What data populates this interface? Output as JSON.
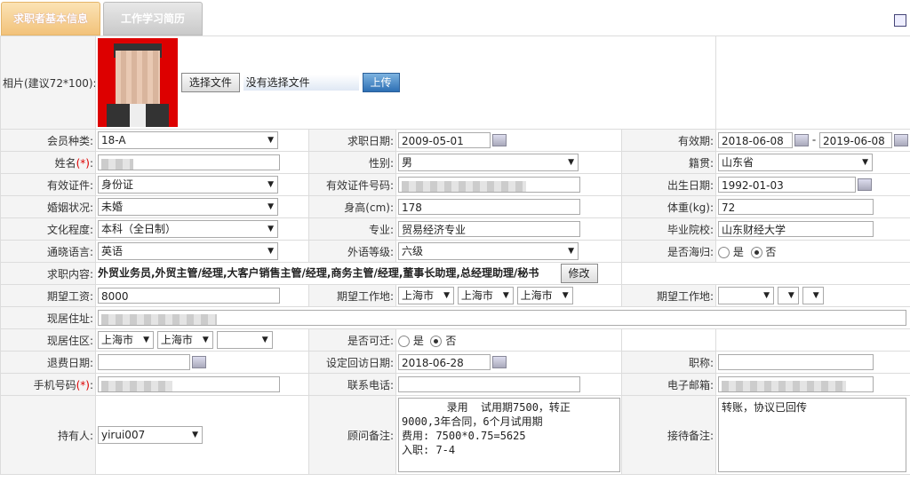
{
  "tabs": {
    "active": "求职者基本信息",
    "inactive": "工作学习简历"
  },
  "photo": {
    "label": "相片(建议72*100):",
    "choose_file": "选择文件",
    "no_file": "没有选择文件",
    "upload": "上传"
  },
  "labels": {
    "member_type": "会员种类:",
    "apply_date": "求职日期:",
    "valid_period": "有效期:",
    "name": "姓名",
    "name_req": "(*)",
    "name_colon": ":",
    "gender": "性别:",
    "native": "籍贯:",
    "id_type": "有效证件:",
    "id_number": "有效证件号码:",
    "birth": "出生日期:",
    "marriage": "婚姻状况:",
    "height": "身高(cm):",
    "weight": "体重(kg):",
    "education": "文化程度:",
    "major": "专业:",
    "school": "毕业院校:",
    "language": "通晓语言:",
    "lang_level": "外语等级:",
    "returnee": "是否海归:",
    "job_content": "求职内容:",
    "salary": "期望工资:",
    "work_place": "期望工作地:",
    "work_place2": "期望工作地:",
    "address": "现居住址:",
    "area": "现居住区:",
    "relocate": "是否可迁:",
    "refund_date": "退费日期:",
    "callback_date": "设定回访日期:",
    "title": "职称:",
    "mobile": "手机号码",
    "mobile_req": "(*)",
    "mobile_colon": ":",
    "phone": "联系电话:",
    "email": "电子邮箱:",
    "holder": "持有人:",
    "consultant_note": "顾问备注:",
    "reception_note": "接待备注:"
  },
  "values": {
    "member_type": "18-A",
    "apply_date": "2009-05-01",
    "valid_from": "2018-06-08",
    "valid_sep": "-",
    "valid_to": "2019-06-08",
    "gender": "男",
    "native": "山东省",
    "id_type": "身份证",
    "birth": "1992-01-03",
    "marriage": "未婚",
    "height": "178",
    "weight": "72",
    "education": "本科（全日制）",
    "major": "贸易经济专业",
    "school": "山东财经大学",
    "language": "英语",
    "lang_level": "六级",
    "yes": "是",
    "no": "否",
    "job_content": "外贸业务员,外贸主管/经理,大客户销售主管/经理,商务主管/经理,董事长助理,总经理助理/秘书",
    "modify": "修改",
    "salary": "8000",
    "wp1": "上海市",
    "wp2": "上海市",
    "wp3": "上海市",
    "area1": "上海市",
    "area2": "上海市",
    "callback_date": "2018-06-28",
    "holder": "yirui007",
    "consultant_note": "       录用  试用期7500，转正\n9000,3年合同，6个月试用期\n费用: 7500*0.75=5625\n入职: 7-4",
    "reception_note": "转账，协议已回传"
  }
}
